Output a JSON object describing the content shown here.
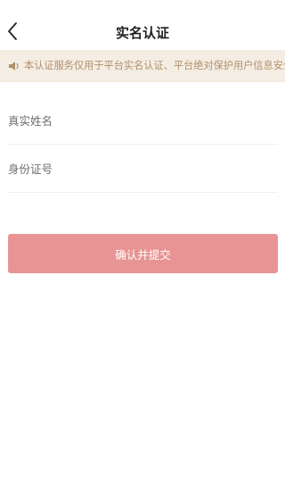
{
  "header": {
    "title": "实名认证",
    "back_icon": "chevron-left-icon"
  },
  "notice": {
    "icon": "speaker-icon",
    "text": "本认证服务仅用于平台实名认证、平台绝对保护用户信息安全",
    "background": "#f4ede4",
    "text_color": "#b2906a"
  },
  "form": {
    "name_placeholder": "真实姓名",
    "name_value": "",
    "id_placeholder": "身份证号",
    "id_value": ""
  },
  "submit": {
    "label": "确认并提交",
    "color": "#e89494"
  }
}
